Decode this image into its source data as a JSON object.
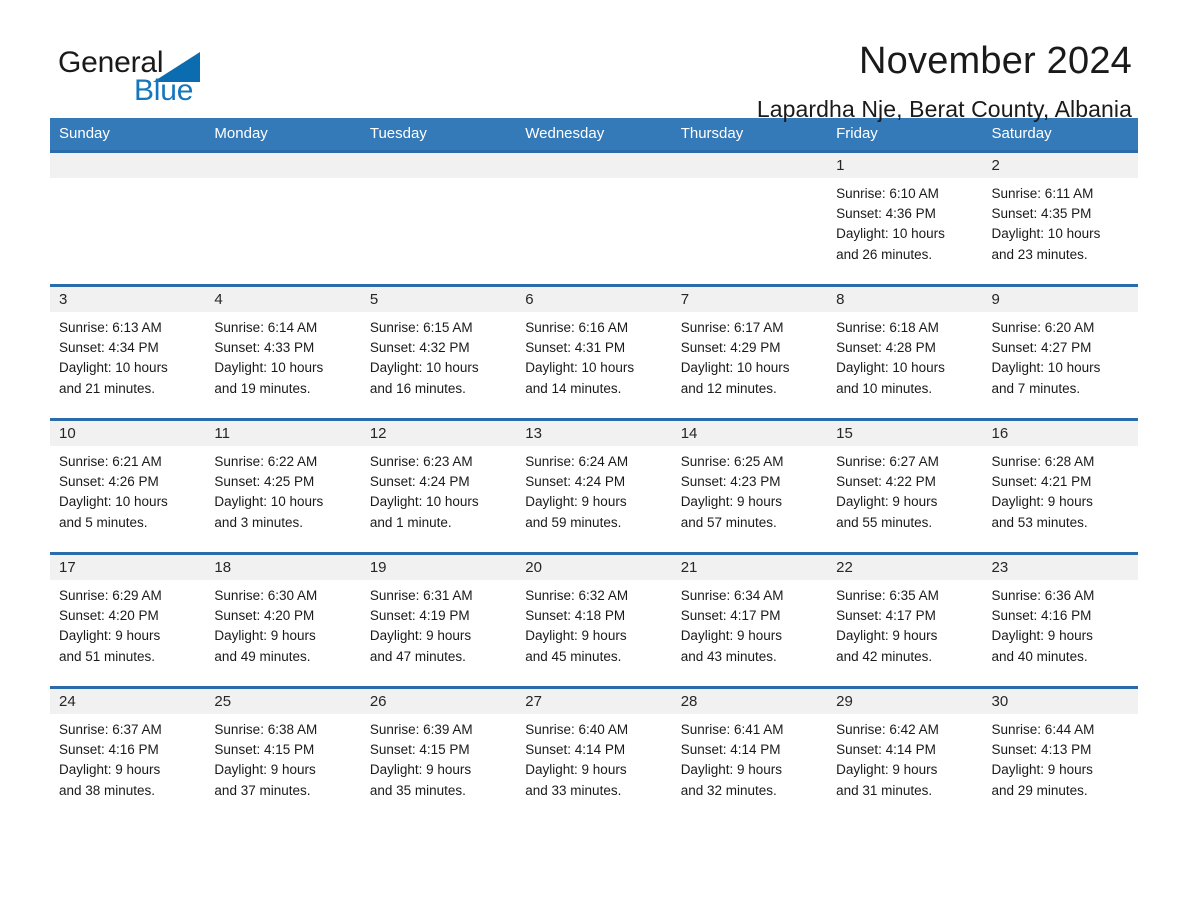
{
  "brand": {
    "word1": "General",
    "word2": "Blue",
    "triangle_color": "#0b6cb0",
    "text_color": "#1576bc"
  },
  "header": {
    "title": "November 2024",
    "subtitle": "Lapardha Nje, Berat County, Albania"
  },
  "theme": {
    "header_bg": "#3479b8",
    "row_border": "#2a6cab",
    "daynum_bg": "#f1f1f1"
  },
  "weekday_headers": [
    "Sunday",
    "Monday",
    "Tuesday",
    "Wednesday",
    "Thursday",
    "Friday",
    "Saturday"
  ],
  "labels": {
    "sunrise_prefix": "Sunrise:",
    "sunset_prefix": "Sunset:",
    "daylight_prefix": "Daylight:"
  },
  "weeks": [
    [
      {
        "day": "",
        "empty": true
      },
      {
        "day": "",
        "empty": true
      },
      {
        "day": "",
        "empty": true
      },
      {
        "day": "",
        "empty": true
      },
      {
        "day": "",
        "empty": true
      },
      {
        "day": "1",
        "sunrise": "Sunrise: 6:10 AM",
        "sunset": "Sunset: 4:36 PM",
        "daylight_line1": "Daylight: 10 hours",
        "daylight_line2": "and 26 minutes."
      },
      {
        "day": "2",
        "sunrise": "Sunrise: 6:11 AM",
        "sunset": "Sunset: 4:35 PM",
        "daylight_line1": "Daylight: 10 hours",
        "daylight_line2": "and 23 minutes."
      }
    ],
    [
      {
        "day": "3",
        "sunrise": "Sunrise: 6:13 AM",
        "sunset": "Sunset: 4:34 PM",
        "daylight_line1": "Daylight: 10 hours",
        "daylight_line2": "and 21 minutes."
      },
      {
        "day": "4",
        "sunrise": "Sunrise: 6:14 AM",
        "sunset": "Sunset: 4:33 PM",
        "daylight_line1": "Daylight: 10 hours",
        "daylight_line2": "and 19 minutes."
      },
      {
        "day": "5",
        "sunrise": "Sunrise: 6:15 AM",
        "sunset": "Sunset: 4:32 PM",
        "daylight_line1": "Daylight: 10 hours",
        "daylight_line2": "and 16 minutes."
      },
      {
        "day": "6",
        "sunrise": "Sunrise: 6:16 AM",
        "sunset": "Sunset: 4:31 PM",
        "daylight_line1": "Daylight: 10 hours",
        "daylight_line2": "and 14 minutes."
      },
      {
        "day": "7",
        "sunrise": "Sunrise: 6:17 AM",
        "sunset": "Sunset: 4:29 PM",
        "daylight_line1": "Daylight: 10 hours",
        "daylight_line2": "and 12 minutes."
      },
      {
        "day": "8",
        "sunrise": "Sunrise: 6:18 AM",
        "sunset": "Sunset: 4:28 PM",
        "daylight_line1": "Daylight: 10 hours",
        "daylight_line2": "and 10 minutes."
      },
      {
        "day": "9",
        "sunrise": "Sunrise: 6:20 AM",
        "sunset": "Sunset: 4:27 PM",
        "daylight_line1": "Daylight: 10 hours",
        "daylight_line2": "and 7 minutes."
      }
    ],
    [
      {
        "day": "10",
        "sunrise": "Sunrise: 6:21 AM",
        "sunset": "Sunset: 4:26 PM",
        "daylight_line1": "Daylight: 10 hours",
        "daylight_line2": "and 5 minutes."
      },
      {
        "day": "11",
        "sunrise": "Sunrise: 6:22 AM",
        "sunset": "Sunset: 4:25 PM",
        "daylight_line1": "Daylight: 10 hours",
        "daylight_line2": "and 3 minutes."
      },
      {
        "day": "12",
        "sunrise": "Sunrise: 6:23 AM",
        "sunset": "Sunset: 4:24 PM",
        "daylight_line1": "Daylight: 10 hours",
        "daylight_line2": "and 1 minute."
      },
      {
        "day": "13",
        "sunrise": "Sunrise: 6:24 AM",
        "sunset": "Sunset: 4:24 PM",
        "daylight_line1": "Daylight: 9 hours",
        "daylight_line2": "and 59 minutes."
      },
      {
        "day": "14",
        "sunrise": "Sunrise: 6:25 AM",
        "sunset": "Sunset: 4:23 PM",
        "daylight_line1": "Daylight: 9 hours",
        "daylight_line2": "and 57 minutes."
      },
      {
        "day": "15",
        "sunrise": "Sunrise: 6:27 AM",
        "sunset": "Sunset: 4:22 PM",
        "daylight_line1": "Daylight: 9 hours",
        "daylight_line2": "and 55 minutes."
      },
      {
        "day": "16",
        "sunrise": "Sunrise: 6:28 AM",
        "sunset": "Sunset: 4:21 PM",
        "daylight_line1": "Daylight: 9 hours",
        "daylight_line2": "and 53 minutes."
      }
    ],
    [
      {
        "day": "17",
        "sunrise": "Sunrise: 6:29 AM",
        "sunset": "Sunset: 4:20 PM",
        "daylight_line1": "Daylight: 9 hours",
        "daylight_line2": "and 51 minutes."
      },
      {
        "day": "18",
        "sunrise": "Sunrise: 6:30 AM",
        "sunset": "Sunset: 4:20 PM",
        "daylight_line1": "Daylight: 9 hours",
        "daylight_line2": "and 49 minutes."
      },
      {
        "day": "19",
        "sunrise": "Sunrise: 6:31 AM",
        "sunset": "Sunset: 4:19 PM",
        "daylight_line1": "Daylight: 9 hours",
        "daylight_line2": "and 47 minutes."
      },
      {
        "day": "20",
        "sunrise": "Sunrise: 6:32 AM",
        "sunset": "Sunset: 4:18 PM",
        "daylight_line1": "Daylight: 9 hours",
        "daylight_line2": "and 45 minutes."
      },
      {
        "day": "21",
        "sunrise": "Sunrise: 6:34 AM",
        "sunset": "Sunset: 4:17 PM",
        "daylight_line1": "Daylight: 9 hours",
        "daylight_line2": "and 43 minutes."
      },
      {
        "day": "22",
        "sunrise": "Sunrise: 6:35 AM",
        "sunset": "Sunset: 4:17 PM",
        "daylight_line1": "Daylight: 9 hours",
        "daylight_line2": "and 42 minutes."
      },
      {
        "day": "23",
        "sunrise": "Sunrise: 6:36 AM",
        "sunset": "Sunset: 4:16 PM",
        "daylight_line1": "Daylight: 9 hours",
        "daylight_line2": "and 40 minutes."
      }
    ],
    [
      {
        "day": "24",
        "sunrise": "Sunrise: 6:37 AM",
        "sunset": "Sunset: 4:16 PM",
        "daylight_line1": "Daylight: 9 hours",
        "daylight_line2": "and 38 minutes."
      },
      {
        "day": "25",
        "sunrise": "Sunrise: 6:38 AM",
        "sunset": "Sunset: 4:15 PM",
        "daylight_line1": "Daylight: 9 hours",
        "daylight_line2": "and 37 minutes."
      },
      {
        "day": "26",
        "sunrise": "Sunrise: 6:39 AM",
        "sunset": "Sunset: 4:15 PM",
        "daylight_line1": "Daylight: 9 hours",
        "daylight_line2": "and 35 minutes."
      },
      {
        "day": "27",
        "sunrise": "Sunrise: 6:40 AM",
        "sunset": "Sunset: 4:14 PM",
        "daylight_line1": "Daylight: 9 hours",
        "daylight_line2": "and 33 minutes."
      },
      {
        "day": "28",
        "sunrise": "Sunrise: 6:41 AM",
        "sunset": "Sunset: 4:14 PM",
        "daylight_line1": "Daylight: 9 hours",
        "daylight_line2": "and 32 minutes."
      },
      {
        "day": "29",
        "sunrise": "Sunrise: 6:42 AM",
        "sunset": "Sunset: 4:14 PM",
        "daylight_line1": "Daylight: 9 hours",
        "daylight_line2": "and 31 minutes."
      },
      {
        "day": "30",
        "sunrise": "Sunrise: 6:44 AM",
        "sunset": "Sunset: 4:13 PM",
        "daylight_line1": "Daylight: 9 hours",
        "daylight_line2": "and 29 minutes."
      }
    ]
  ]
}
